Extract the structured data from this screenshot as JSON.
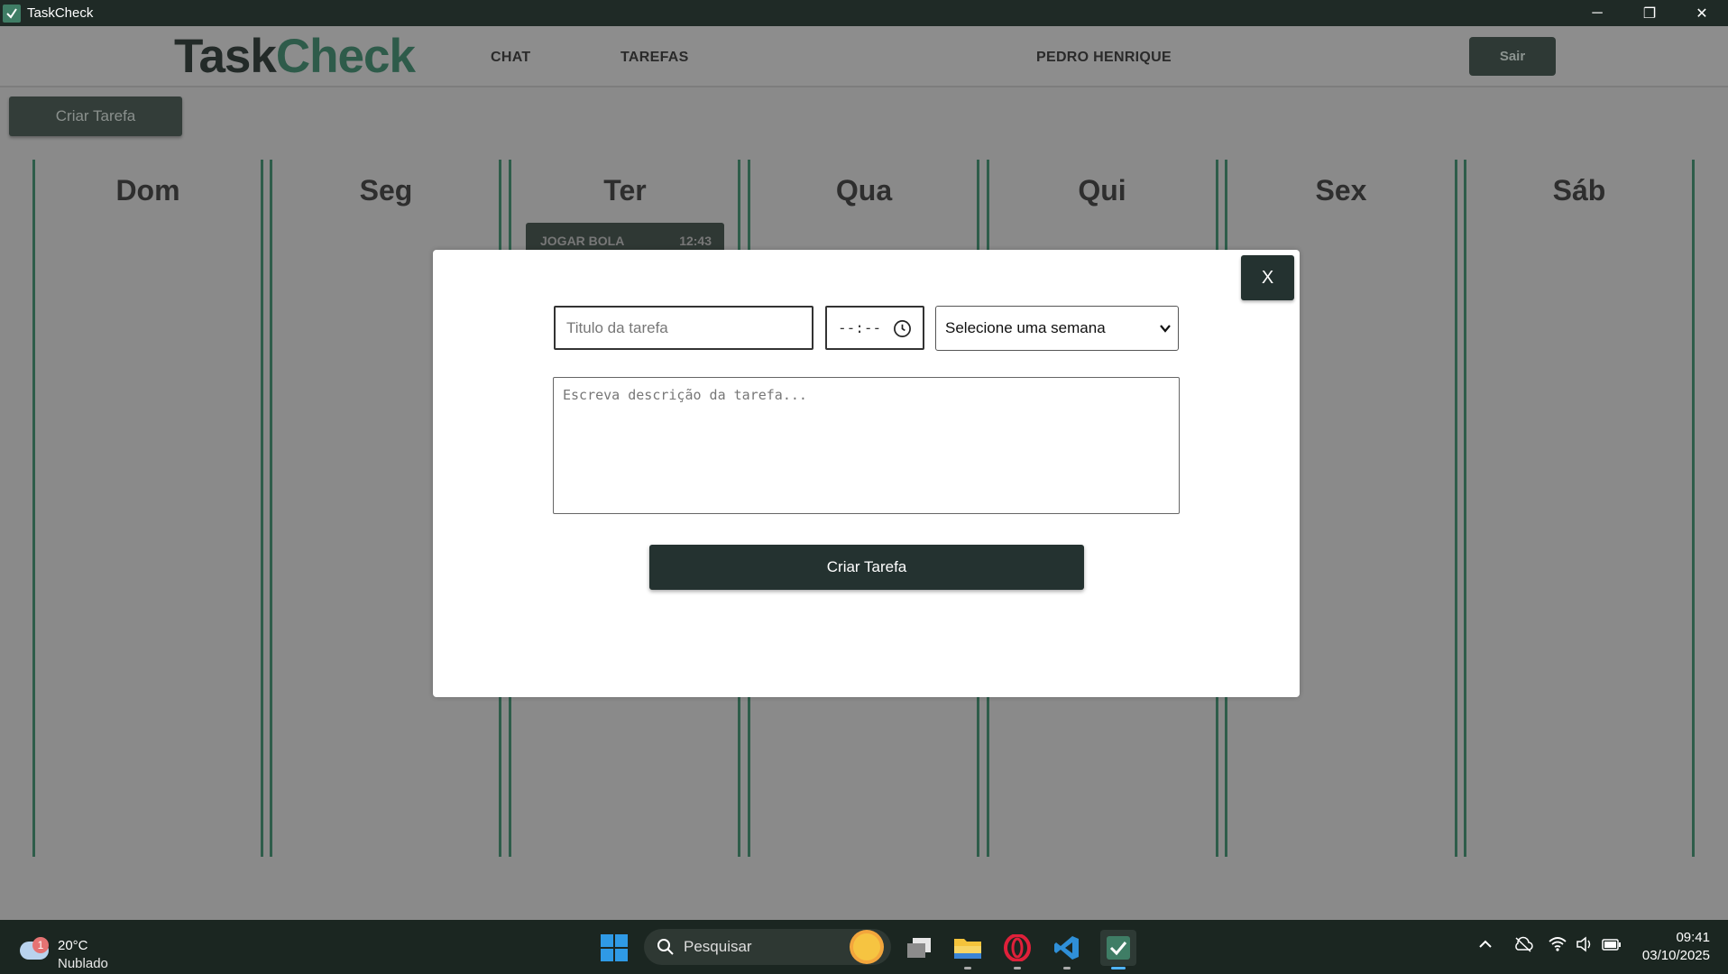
{
  "window": {
    "title": "TaskCheck",
    "minimize": "─",
    "restore": "❐",
    "close": "✕"
  },
  "header": {
    "logo_part1": "Task",
    "logo_part2": "Check",
    "nav": [
      "CHAT",
      "TAREFAS"
    ],
    "user_name": "PEDRO HENRIQUE",
    "logout_label": "Sair"
  },
  "toolbar": {
    "create_label": "Criar Tarefa"
  },
  "week": {
    "days": [
      "Dom",
      "Seg",
      "Ter",
      "Qua",
      "Qui",
      "Sex",
      "Sáb"
    ]
  },
  "tasks": [
    {
      "title": "JOGAR BOLA",
      "time": "12:43",
      "day": "Ter"
    }
  ],
  "modal": {
    "close_label": "X",
    "title_placeholder": "Titulo da tarefa",
    "time_value": "--:--",
    "week_select_value": "Selecione uma semana",
    "description_placeholder": "Escreva descrição da tarefa...",
    "submit_label": "Criar Tarefa"
  },
  "taskbar": {
    "weather_temp": "20°C",
    "weather_condition": "Nublado",
    "weather_badge": "1",
    "search_placeholder": "Pesquisar",
    "time": "09:41",
    "date": "03/10/2025"
  },
  "colors": {
    "accent_green": "#2e5d4a",
    "dark_button": "#243230"
  }
}
